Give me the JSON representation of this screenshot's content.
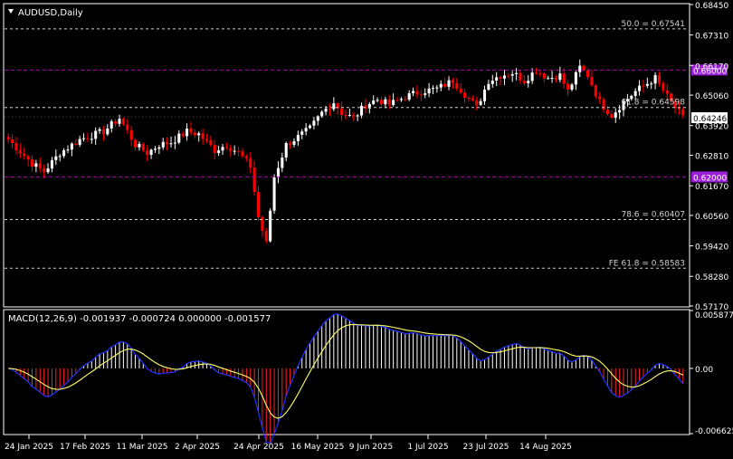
{
  "symbol_title": "AUDUSD,Daily",
  "macd_title": "MACD(12,26,9) -0.001937 -0.000724 0.000000 -0.001577",
  "colors": {
    "bull": "#ffffff",
    "bear": "#ff0000",
    "grid": "#ffffff",
    "level_line": "#cfcfcf",
    "magenta_line": "#b000b0",
    "macd_line": "#2233ff",
    "signal_line": "#ffff66",
    "price_badge": "#ffffff",
    "magenta_badge": "#9a1fd6"
  },
  "price_axis": {
    "min": 0.5717,
    "max": 0.6845,
    "ticks": [
      "0.68450",
      "0.67310",
      "0.66170",
      "0.65060",
      "0.63920",
      "0.62810",
      "0.61670",
      "0.60560",
      "0.59420",
      "0.58280",
      "0.57170"
    ]
  },
  "current_price": "0.64246",
  "levels": [
    {
      "label": "50.0 = 0.67541",
      "value": 0.67541,
      "kind": "fib"
    },
    {
      "label": "0.66000",
      "value": 0.66,
      "kind": "magenta"
    },
    {
      "label": "61.8 = 0.64598",
      "value": 0.64598,
      "kind": "fib"
    },
    {
      "label": "0.62000",
      "value": 0.62,
      "kind": "magenta"
    },
    {
      "label": "78.6 = 0.60407",
      "value": 0.60407,
      "kind": "fib"
    },
    {
      "label": "FE 61.8 = 0.58583",
      "value": 0.58583,
      "kind": "fib"
    }
  ],
  "macd_axis": {
    "min": -0.006625,
    "max": 0.005877,
    "ticks": [
      "0.005877",
      "0.00",
      "-0.006625"
    ]
  },
  "time_labels": [
    "24 Jan 2025",
    "17 Feb 2025",
    "11 Mar 2025",
    "2 Apr 2025",
    "24 Apr 2025",
    "16 May 2025",
    "9 Jun 2025",
    "1 Jul 2025",
    "23 Jul 2025",
    "14 Aug 2025"
  ],
  "chart_data": {
    "type": "candlestick",
    "keypoints": [
      [
        0,
        0.634
      ],
      [
        6,
        0.625
      ],
      [
        9,
        0.622
      ],
      [
        13,
        0.629
      ],
      [
        18,
        0.634
      ],
      [
        24,
        0.637
      ],
      [
        28,
        0.642
      ],
      [
        32,
        0.632
      ],
      [
        35,
        0.629
      ],
      [
        38,
        0.632
      ],
      [
        41,
        0.633
      ],
      [
        45,
        0.637
      ],
      [
        48,
        0.636
      ],
      [
        52,
        0.63
      ],
      [
        55,
        0.632
      ],
      [
        58,
        0.629
      ],
      [
        61,
        0.624
      ],
      [
        63,
        0.605
      ],
      [
        65,
        0.595
      ],
      [
        67,
        0.62
      ],
      [
        70,
        0.632
      ],
      [
        73,
        0.635
      ],
      [
        76,
        0.638
      ],
      [
        79,
        0.644
      ],
      [
        82,
        0.648
      ],
      [
        84,
        0.644
      ],
      [
        87,
        0.642
      ],
      [
        90,
        0.647
      ],
      [
        93,
        0.649
      ],
      [
        96,
        0.647
      ],
      [
        100,
        0.65
      ],
      [
        104,
        0.652
      ],
      [
        108,
        0.653
      ],
      [
        112,
        0.656
      ],
      [
        115,
        0.651
      ],
      [
        118,
        0.646
      ],
      [
        121,
        0.656
      ],
      [
        124,
        0.658
      ],
      [
        127,
        0.659
      ],
      [
        130,
        0.656
      ],
      [
        133,
        0.66
      ],
      [
        136,
        0.657
      ],
      [
        139,
        0.658
      ],
      [
        141,
        0.652
      ],
      [
        144,
        0.661
      ],
      [
        146,
        0.658
      ],
      [
        149,
        0.648
      ],
      [
        152,
        0.643
      ],
      [
        155,
        0.648
      ],
      [
        158,
        0.652
      ],
      [
        161,
        0.655
      ],
      [
        163,
        0.657
      ],
      [
        166,
        0.65
      ],
      [
        168,
        0.646
      ],
      [
        170,
        0.642
      ]
    ]
  }
}
